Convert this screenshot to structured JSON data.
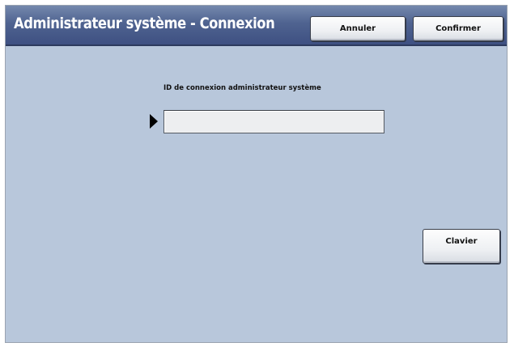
{
  "header": {
    "title": "Administrateur système - Connexion",
    "cancel_label": "Annuler",
    "confirm_label": "Confirmer"
  },
  "form": {
    "field_label": "ID de connexion administrateur système",
    "login_value": "",
    "focus_indicator": "right-triangle-arrow-icon"
  },
  "actions": {
    "keyboard_label": "Clavier"
  },
  "colors": {
    "title_bar": "#4f6390",
    "background": "#b8c7db",
    "title_text": "#ffffff"
  }
}
